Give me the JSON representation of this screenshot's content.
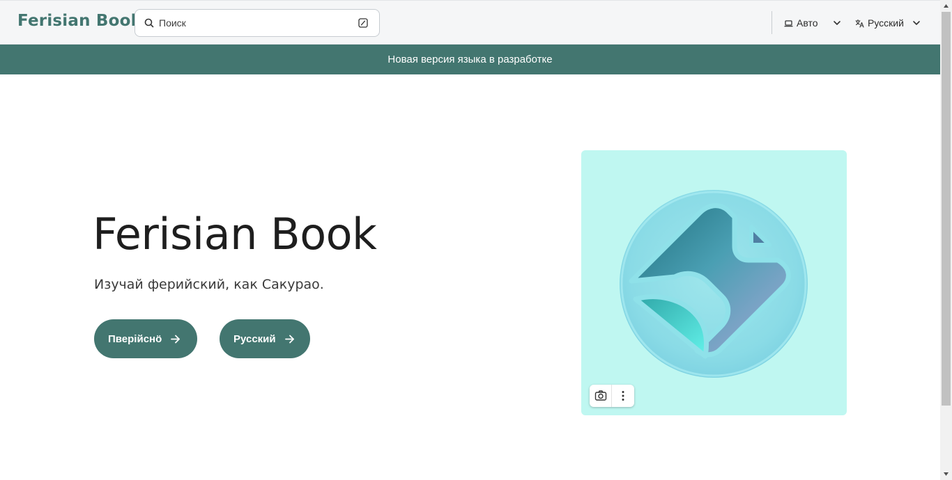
{
  "header": {
    "logo": "Ferisian Book",
    "search_placeholder": "Поиск",
    "theme_label": "Авто",
    "language_label": "Русский"
  },
  "banner": {
    "text": "Новая версия языка в разработке"
  },
  "hero": {
    "title": "Ferisian Book",
    "subtitle": "Изучай ферийский, как Сакурао.",
    "buttons": [
      {
        "label": "Пверійснӧ"
      },
      {
        "label": "Русский"
      }
    ]
  },
  "image": {
    "icon": "app-logo-icon",
    "tools": [
      "camera-search-icon",
      "more-vertical-icon"
    ]
  },
  "colors": {
    "accent": "#437670",
    "image_background": "#bff7f1",
    "header_background": "#f5f6f7"
  }
}
